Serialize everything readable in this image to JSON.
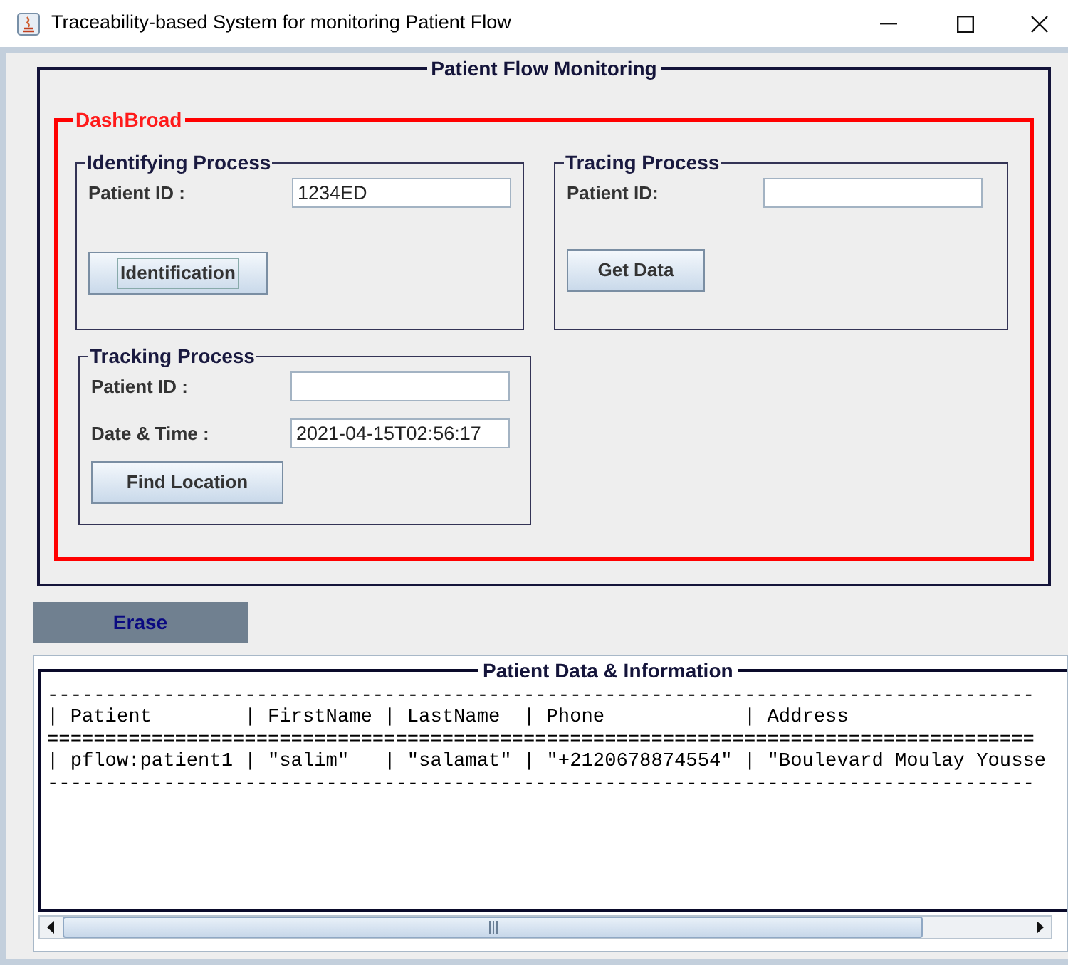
{
  "window": {
    "title": "Traceability-based System for monitoring Patient Flow"
  },
  "panel": {
    "title": "Patient Flow Monitoring"
  },
  "dashboard": {
    "title": "DashBroad",
    "groups": [
      {
        "title": "Identifying Process",
        "fields": [
          {
            "label": "Patient ID :",
            "value": "1234ED"
          }
        ],
        "button": {
          "label": "Identification",
          "focused": true
        }
      },
      {
        "title": "Tracing Process",
        "fields": [
          {
            "label": "Patient ID:"
          }
        ],
        "button": {
          "label": "Get Data",
          "focused": false
        }
      },
      {
        "title": "Tracking Process",
        "fields": [
          {
            "label": "Patient ID :"
          },
          {
            "label": "Date & Time :",
            "value": "2021-04-15T02:56:17"
          }
        ],
        "button": {
          "label": "Find Location",
          "focused": false
        }
      }
    ]
  },
  "erase_button": {
    "label": "Erase"
  },
  "output": {
    "title": "Patient Data & Information",
    "lines": [
      "-------------------------------------------------------------------------------------",
      "| Patient        | FirstName | LastName  | Phone            | Address",
      "=====================================================================================",
      "| pflow:patient1 | \"salim\"   | \"salamat\" | \"+2120678874554\" | \"Boulevard Moulay Yousse",
      "-------------------------------------------------------------------------------------"
    ]
  }
}
